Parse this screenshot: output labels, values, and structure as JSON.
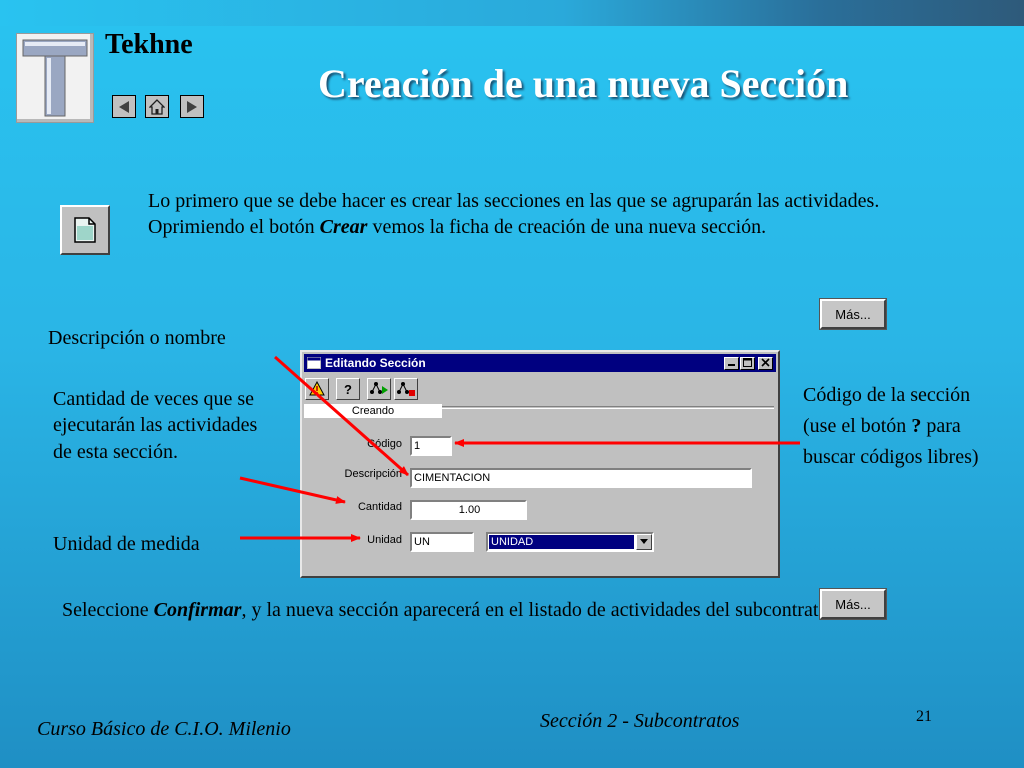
{
  "brand": "Tekhne",
  "logo_letter": "T",
  "title": "Creación de una nueva Sección",
  "intro": {
    "line1": "Lo primero que se debe hacer es crear las secciones en las que se agruparán las actividades.",
    "line2_before": "Oprimiendo el botón ",
    "line2_emph": "Crear",
    "line2_after": " vemos la ficha de creación de una nueva sección."
  },
  "mas_button_top": "Más...",
  "mas_button_bottom": "Más...",
  "labels_left": {
    "descripcion": "Descripción o nombre",
    "cantidad": "Cantidad de veces que se ejecutarán las actividades de esta sección.",
    "unidad": "Unidad de medida"
  },
  "right_note": {
    "before": "Código de la sección (use el botón ",
    "emph": "?",
    "after": " para buscar códigos libres)"
  },
  "dialog": {
    "title": "Editando Sección",
    "toolbar_help": "?",
    "status": "Creando",
    "fields": {
      "codigo_label": "Código",
      "codigo_value": "1",
      "descripcion_label": "Descripción",
      "descripcion_value": "CIMENTACION",
      "cantidad_label": "Cantidad",
      "cantidad_value": "1.00",
      "unidad_label": "Unidad",
      "unidad_code": "UN",
      "unidad_select": "UNIDAD"
    }
  },
  "bottom": {
    "before": "Seleccione ",
    "emph": "Confirmar",
    "after": ", y la nueva sección aparecerá en el listado de actividades del subcontrato."
  },
  "footer_left": "Curso Básico de C.I.O. Milenio",
  "footer_center": "Sección 2 - Subcontratos",
  "page_number": "21",
  "colors": {
    "accent_title": "#ffffff",
    "arrow": "#ff0000",
    "titlebar": "#000080"
  }
}
